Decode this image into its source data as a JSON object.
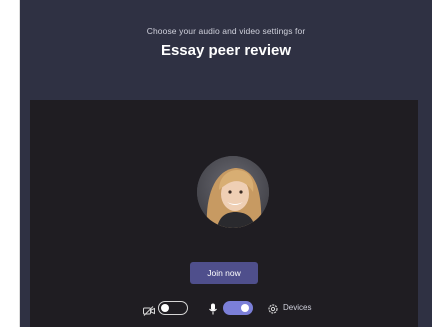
{
  "header": {
    "subtitle": "Choose your audio and video settings for",
    "meeting_title": "Essay peer review"
  },
  "preview": {
    "join_label": "Join now"
  },
  "controls": {
    "camera_toggle": "off",
    "mic_toggle": "on",
    "devices_label": "Devices"
  },
  "colors": {
    "background": "#2f3143",
    "preview_bg": "#1f1d22",
    "join_button": "#4f4f8c",
    "toggle_on": "#7b7fd8"
  },
  "icons": [
    "camera-off-icon",
    "microphone-icon",
    "gear-icon"
  ]
}
